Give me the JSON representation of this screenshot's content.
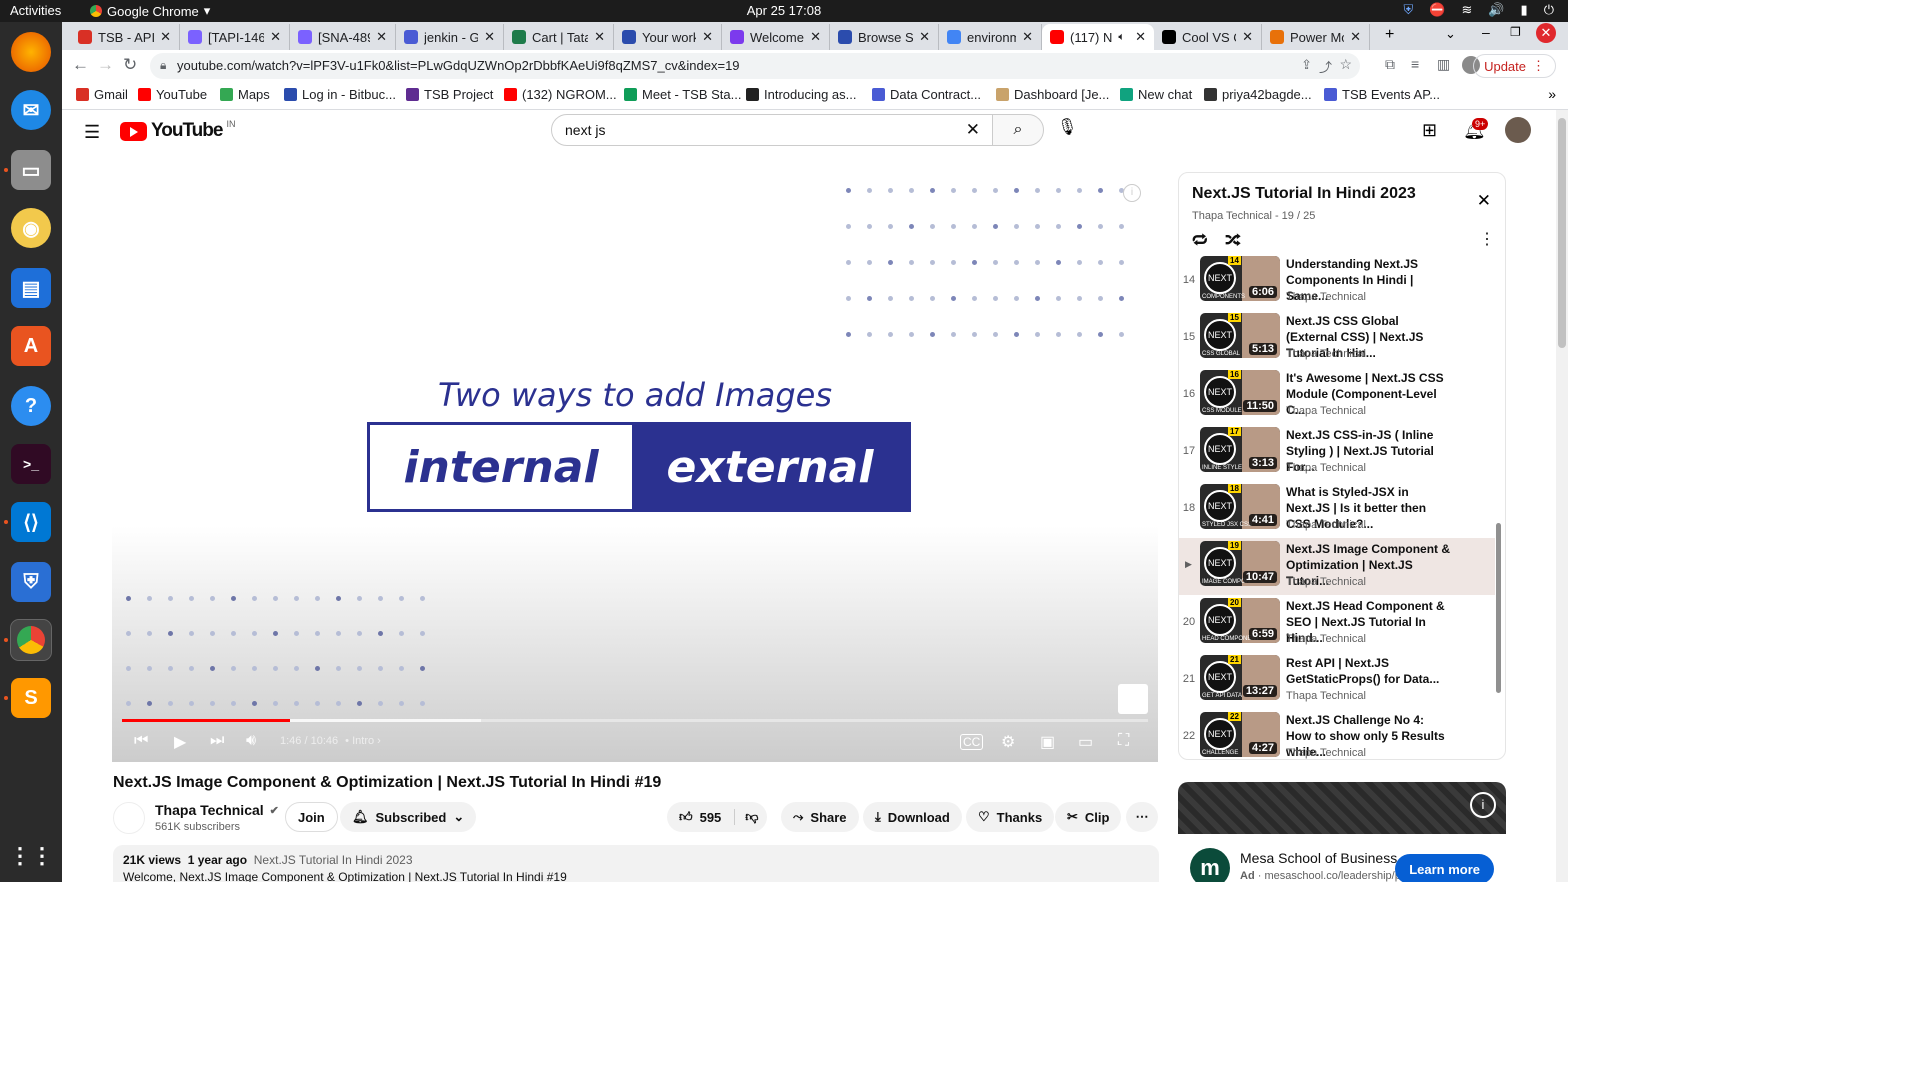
{
  "os": {
    "activities": "Activities",
    "app_name": "Google Chrome",
    "clock": "Apr 25  17:08"
  },
  "browser": {
    "tabs": [
      {
        "label": "TSB - API -",
        "color": "#d93025"
      },
      {
        "label": "[TAPI-146]",
        "color": "#7b61ff"
      },
      {
        "label": "[SNA-4895",
        "color": "#7b61ff"
      },
      {
        "label": "jenkin - Go",
        "color": "#4a5bd4"
      },
      {
        "label": "Cart | Tata",
        "color": "#1e7b4a"
      },
      {
        "label": "Your work",
        "color": "#2b4cad"
      },
      {
        "label": "Welcome",
        "color": "#7c3aed"
      },
      {
        "label": "Browse St",
        "color": "#2b4cad"
      },
      {
        "label": "environme",
        "color": "#4285f4"
      },
      {
        "label": "(117) N",
        "color": "#ff0000"
      },
      {
        "label": "Cool VS Co",
        "color": "#000000"
      },
      {
        "label": "Power Mo",
        "color": "#e8710a"
      }
    ],
    "url": "youtube.com/watch?v=lPF3V-u1Fk0&list=PLwGdqUZWnOp2rDbbfKAeUi9f8qZMS7_cv&index=19",
    "update_label": "Update",
    "bookmarks": [
      "Gmail",
      "YouTube",
      "Maps",
      "Log in - Bitbuc...",
      "TSB Project",
      "(132) NGROM...",
      "Meet - TSB Sta...",
      "Introducing as...",
      "Data Contract...",
      "Dashboard [Je...",
      "New chat",
      "priya42bagde...",
      "TSB Events AP..."
    ]
  },
  "youtube": {
    "logo_text": "YouTube",
    "country": "IN",
    "search_value": "next js",
    "notif_count": "9+",
    "video": {
      "slide_title": "Two ways to add Images",
      "left_word": "internal",
      "right_word": "external",
      "time": "1:46 / 10:46",
      "chapter": "Intro",
      "progress": 0.164
    },
    "title": "Next.JS Image Component & Optimization | Next.JS Tutorial In Hindi #19",
    "channel": "Thapa Technical",
    "subscribers": "561K subscribers",
    "join": "Join",
    "subscribed": "Subscribed",
    "likes": "595",
    "share": "Share",
    "download": "Download",
    "thanks": "Thanks",
    "clip": "Clip",
    "views": "21K views",
    "age": "1 year ago",
    "playlist_link": "Next.JS Tutorial In Hindi 2023",
    "desc_line": "Welcome, Next.JS Image Component & Optimization | Next.JS Tutorial In Hindi #19"
  },
  "playlist": {
    "title": "Next.JS Tutorial In Hindi 2023",
    "sub": "Thapa Technical - 19 / 25",
    "items": [
      {
        "num": "14",
        "title": "Understanding Next.JS Components In Hindi | Same...",
        "channel": "Thapa Technical",
        "duration": "6:06",
        "tag": "COMPONENTS"
      },
      {
        "num": "15",
        "title": "Next.JS CSS Global (External CSS) | Next.JS Tutorial In Hin...",
        "channel": "Thapa Technical",
        "duration": "5:13",
        "tag": "CSS GLOBAL"
      },
      {
        "num": "16",
        "title": "It's Awesome | Next.JS CSS Module (Component-Level C...",
        "channel": "Thapa Technical",
        "duration": "11:50",
        "tag": "CSS MODULE"
      },
      {
        "num": "17",
        "title": "Next.JS CSS-in-JS ( Inline Styling ) | Next.JS Tutorial For...",
        "channel": "Thapa Technical",
        "duration": "3:13",
        "tag": "INLINE STYLE"
      },
      {
        "num": "18",
        "title": "What is Styled-JSX in Next.JS | Is it better then CSS Module?...",
        "channel": "Thapa Technical",
        "duration": "4:41",
        "tag": "STYLED JSX CSS"
      },
      {
        "num": "19",
        "title": "Next.JS Image Component & Optimization | Next.JS Tutori...",
        "channel": "Thapa Technical",
        "duration": "10:47",
        "tag": "IMAGE COMPON"
      },
      {
        "num": "20",
        "title": "Next.JS Head Component & SEO | Next.JS Tutorial In Hind...",
        "channel": "Thapa Technical",
        "duration": "6:59",
        "tag": "HEAD COMPONENT"
      },
      {
        "num": "21",
        "title": "Rest API | Next.JS GetStaticProps() for Data...",
        "channel": "Thapa Technical",
        "duration": "13:27",
        "tag": "GET API DATA"
      },
      {
        "num": "22",
        "title": "Next.JS Challenge No 4: How to show only 5 Results while...",
        "channel": "Thapa Technical",
        "duration": "4:27",
        "tag": "CHALLENGE"
      }
    ]
  },
  "ad": {
    "name": "Mesa School of Business",
    "ad_label": "Ad",
    "url": "mesaschool.co/leadership/prog",
    "cta": "Learn more"
  }
}
